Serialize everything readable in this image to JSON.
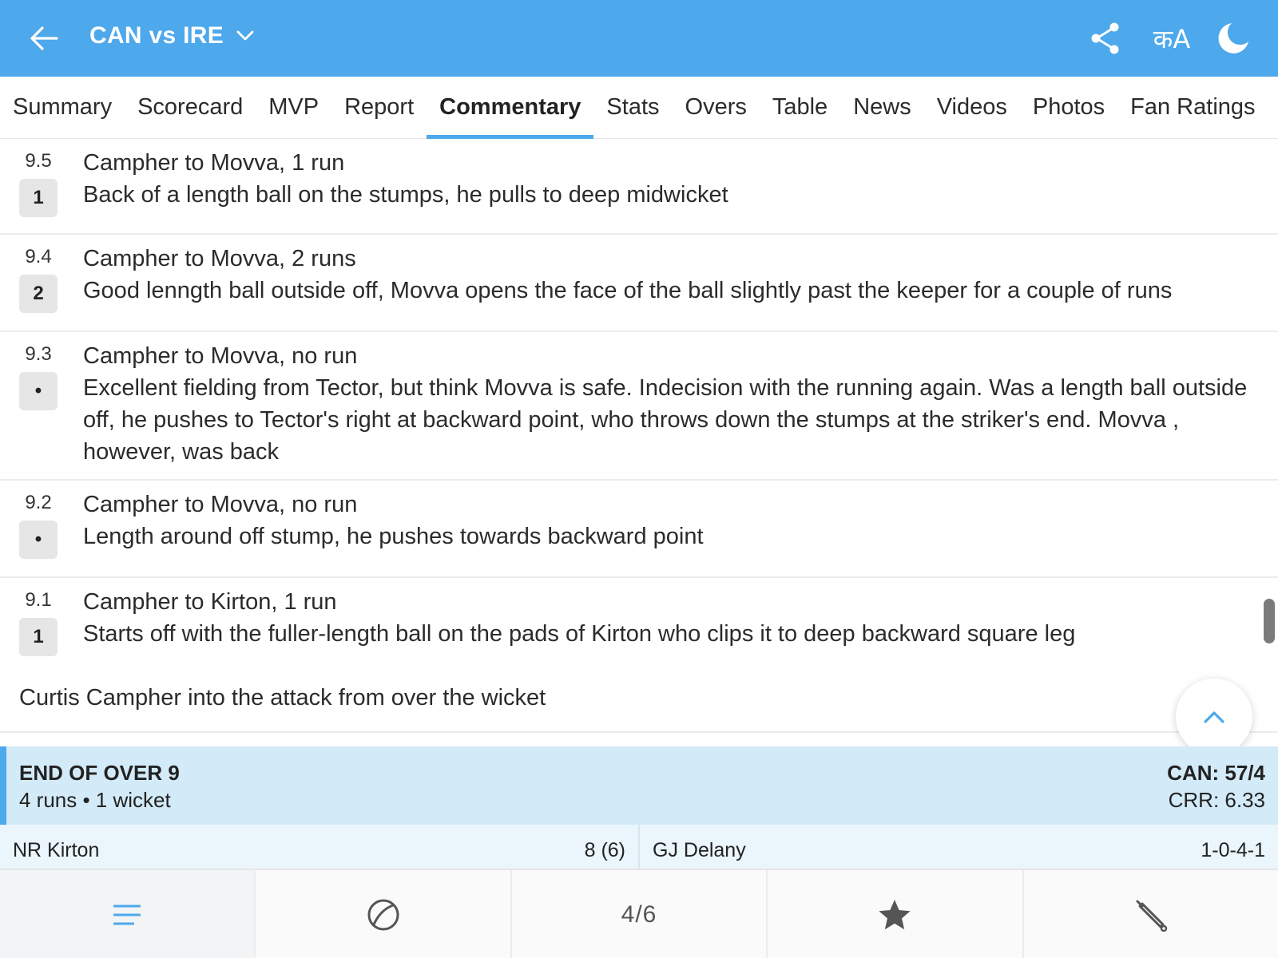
{
  "header": {
    "title": "CAN vs IRE",
    "language_label": "कA",
    "back_icon": "arrow-left-icon",
    "share_icon": "share-icon",
    "theme_icon": "moon-icon",
    "colors": {
      "bar": "#4da8ec"
    }
  },
  "tabs": [
    {
      "label": "Summary"
    },
    {
      "label": "Scorecard"
    },
    {
      "label": "MVP"
    },
    {
      "label": "Report"
    },
    {
      "label": "Commentary",
      "active": true
    },
    {
      "label": "Stats"
    },
    {
      "label": "Overs"
    },
    {
      "label": "Table"
    },
    {
      "label": "News"
    },
    {
      "label": "Videos"
    },
    {
      "label": "Photos"
    },
    {
      "label": "Fan Ratings"
    }
  ],
  "commentary": [
    {
      "over": "9.5",
      "result": "1",
      "headline": "Campher to Movva, 1 run",
      "text": "Back of a length ball on the stumps, he pulls to deep midwicket"
    },
    {
      "over": "9.4",
      "result": "2",
      "headline": "Campher to Movva, 2 runs",
      "text": "Good lenngth ball outside off, Movva opens the face of the ball slightly past the keeper for a couple of runs"
    },
    {
      "over": "9.3",
      "result": "•",
      "headline": "Campher to Movva, no run",
      "text": "Excellent fielding from Tector, but think Movva is safe. Indecision with the running again. Was a length ball outside off, he pushes to Tector's right at backward point, who throws down the stumps at the striker's end. Movva , however, was back"
    },
    {
      "over": "9.2",
      "result": "•",
      "headline": "Campher to Movva, no run",
      "text": "Length around off stump, he pushes towards backward point"
    },
    {
      "over": "9.1",
      "result": "1",
      "headline": "Campher to Kirton, 1 run",
      "text": "Starts off with the fuller-length ball on the pads of Kirton who clips it to deep backward square leg"
    }
  ],
  "note": "Curtis Campher into the attack from over the wicket",
  "end_of_over": {
    "title": "END OF OVER 9",
    "summary": "4 runs • 1 wicket",
    "score": "CAN: 57/4",
    "crr": "CRR: 6.33"
  },
  "players": [
    {
      "name": "NR Kirton",
      "value": "8 (6)"
    },
    {
      "name": "GJ Delany",
      "value": "1-0-4-1"
    }
  ],
  "bottom_nav": {
    "menu_icon": "menu-lines-icon",
    "ball_icon": "cricket-ball-icon",
    "page_label": "4/6",
    "star_icon": "star-icon",
    "bat_icon": "cricket-bat-icon"
  }
}
